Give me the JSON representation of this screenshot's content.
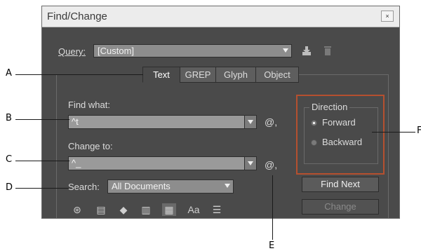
{
  "window": {
    "title": "Find/Change",
    "close_glyph": "×"
  },
  "query": {
    "label": "Query:",
    "value": "[Custom]",
    "save_icon": "save-query-icon",
    "delete_icon": "trash-icon"
  },
  "tabs": [
    {
      "label": "Text",
      "active": true
    },
    {
      "label": "GREP",
      "active": false
    },
    {
      "label": "Glyph",
      "active": false
    },
    {
      "label": "Object",
      "active": false
    }
  ],
  "find": {
    "label": "Find what:",
    "value": "^t",
    "special_char": "@,"
  },
  "change": {
    "label": "Change to:",
    "value": "^_",
    "special_char": "@,"
  },
  "search": {
    "label": "Search:",
    "value": "All Documents"
  },
  "direction": {
    "label": "Direction",
    "options": [
      "Forward",
      "Backward"
    ],
    "selected": "Forward"
  },
  "buttons": {
    "find_next": "Find Next",
    "change": "Change"
  },
  "option_icons": [
    "include-locked-layers-icon",
    "include-locked-stories-icon",
    "include-hidden-layers-icon",
    "include-master-pages-icon",
    "include-footnotes-icon",
    "case-sensitive-icon",
    "whole-word-icon"
  ],
  "option_icon_glyphs": [
    "⊛",
    "▤",
    "◆",
    "▥",
    "▦",
    "Aa",
    "☰"
  ],
  "callouts": [
    "A",
    "B",
    "C",
    "D",
    "E",
    "F"
  ],
  "colors": {
    "highlight_border": "#b5502f",
    "dialog_bg": "#4a4a4a"
  }
}
